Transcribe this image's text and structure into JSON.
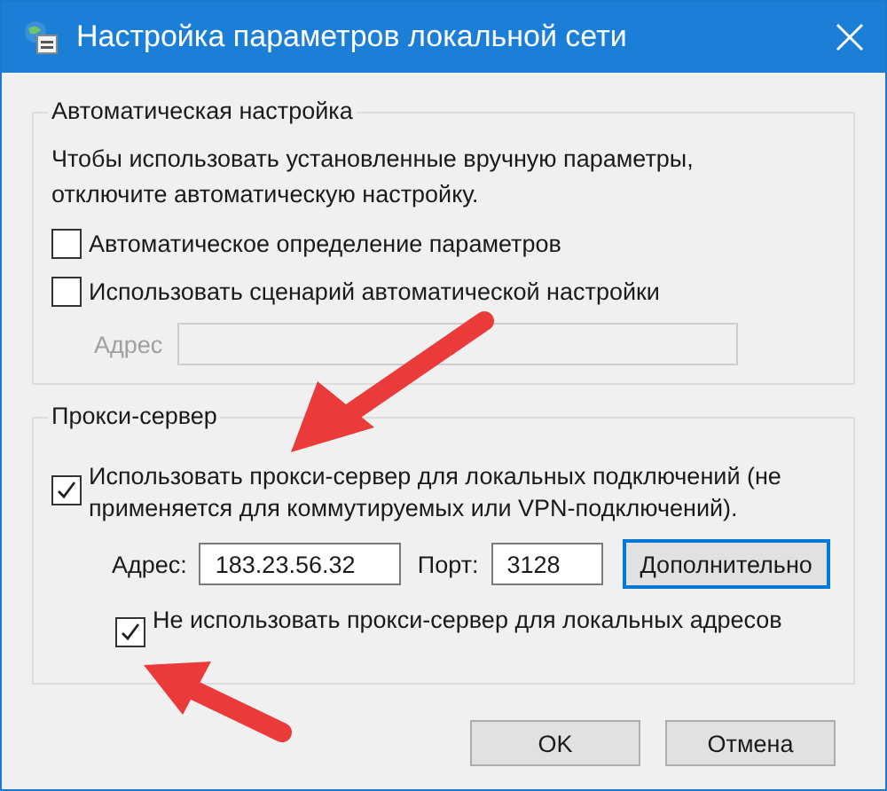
{
  "window": {
    "title": "Настройка параметров локальной сети"
  },
  "auto_config": {
    "legend": "Автоматическая настройка",
    "note": "Чтобы использовать установленные вручную параметры,\nотключите автоматическую настройку.",
    "options": [
      {
        "label": "Автоматическое определение параметров",
        "checked": false
      },
      {
        "label": "Использовать сценарий автоматической настройки",
        "checked": false
      }
    ],
    "address": {
      "label": "Адрес",
      "disabled": true
    }
  },
  "proxy": {
    "legend": "Прокси-сервер",
    "use_proxy": {
      "label": "Использовать прокси-сервер для локальных подключений (не\nприменяется для коммутируемых или VPN-подключений).",
      "checked": true
    },
    "address_label": "Адрес:",
    "address": "183.23.56.32",
    "port_label": "Порт:",
    "port": "3128",
    "advanced_button": "Дополнительно",
    "bypass_local": {
      "label": "Не использовать прокси-сервер для локальных адресов",
      "checked": true
    }
  },
  "buttons": [
    "OK",
    "Отмена"
  ]
}
